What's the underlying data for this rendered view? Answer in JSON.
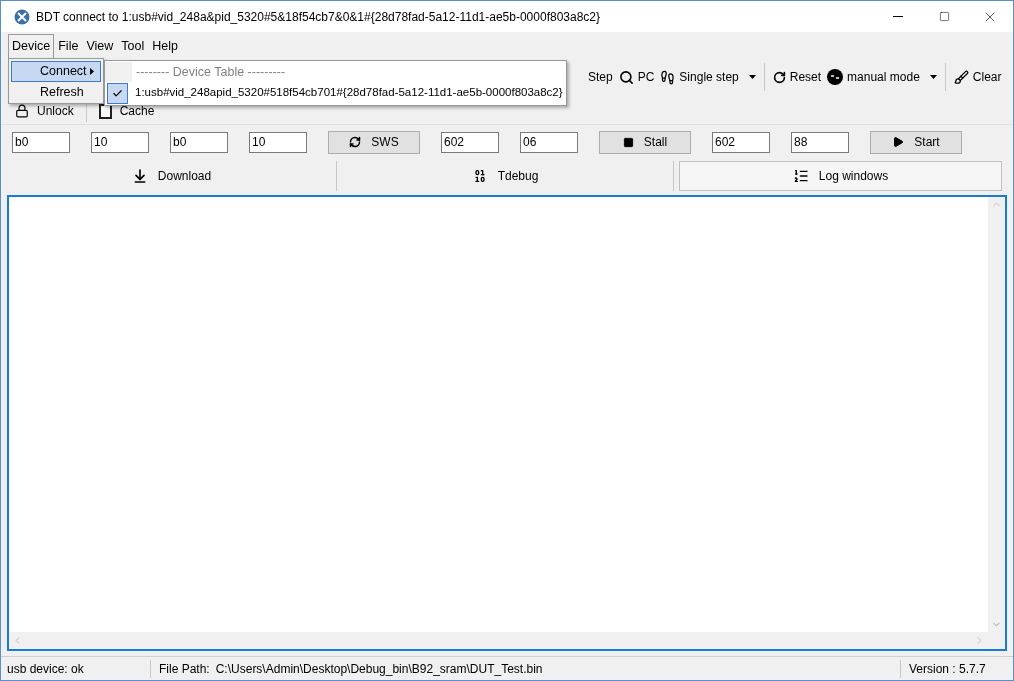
{
  "window": {
    "title": "BDT connect to 1:usb#vid_248a&pid_5320#5&18f54cb7&0&1#{28d78fad-5a12-11d1-ae5b-0000f803a8c2}"
  },
  "menu_bar": [
    {
      "label": "Device",
      "selected": true
    },
    {
      "label": "File",
      "selected": false
    },
    {
      "label": "View",
      "selected": false
    },
    {
      "label": "Tool",
      "selected": false
    },
    {
      "label": "Help",
      "selected": false
    }
  ],
  "device_menu": [
    {
      "label": "Connect",
      "selected": true,
      "has_submenu": true
    },
    {
      "label": "Refresh",
      "selected": false,
      "has_submenu": false
    }
  ],
  "connect_submenu": {
    "header": "-------- Device Table ---------",
    "devices": [
      {
        "label": "1:usb#vid_248apid_5320#518f54cb701#{28d78fad-5a12-11d1-ae5b-0000f803a8c2}",
        "checked": true
      }
    ]
  },
  "toolbar": [
    {
      "label": "Step",
      "kind": "button"
    },
    {
      "label": "PC",
      "kind": "button"
    },
    {
      "label": "Single step",
      "kind": "dropdown"
    },
    {
      "label": "Reset",
      "kind": "button"
    },
    {
      "label": "manual mode",
      "kind": "dropdown"
    },
    {
      "label": "Clear",
      "kind": "button"
    }
  ],
  "toolbar2": [
    {
      "label": "Unlock",
      "kind": "lock"
    },
    {
      "label": "Cache",
      "kind": "checkbox",
      "checked": false
    }
  ],
  "params": [
    {
      "kind": "field",
      "value": "b0"
    },
    {
      "kind": "field",
      "value": "10"
    },
    {
      "kind": "field",
      "value": "b0"
    },
    {
      "kind": "field",
      "value": "10"
    },
    {
      "kind": "button",
      "label": "SWS"
    },
    {
      "kind": "field",
      "value": "602"
    },
    {
      "kind": "field",
      "value": "06"
    },
    {
      "kind": "button",
      "label": "Stall"
    },
    {
      "kind": "field",
      "value": "602"
    },
    {
      "kind": "field",
      "value": "88"
    },
    {
      "kind": "button",
      "label": "Start"
    }
  ],
  "tabs": [
    {
      "label": "Download",
      "selected": false
    },
    {
      "label": "Tdebug",
      "selected": false
    },
    {
      "label": "Log windows",
      "selected": true
    }
  ],
  "status_bar": {
    "device": "usb device: ok",
    "file_path_label": "File Path:",
    "file_path": "C:\\Users\\Admin\\Desktop\\Debug_bin\\B92_sram\\DUT_Test.bin",
    "version": "Version : 5.7.7"
  }
}
